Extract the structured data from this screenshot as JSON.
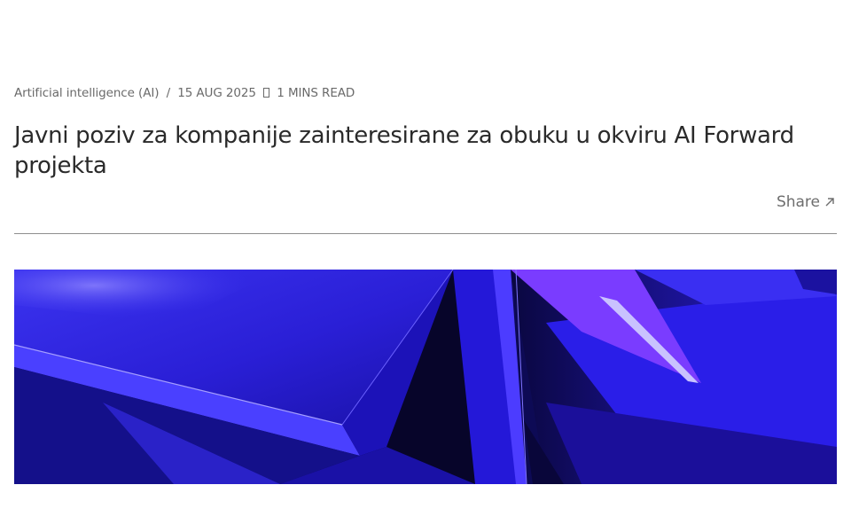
{
  "article": {
    "category": "Artificial intelligence (AI)",
    "separator": "/",
    "date": "15 AUG 2025",
    "read_time": "1 MINS READ",
    "title": "Javni poziv za kompanije zainteresirane za obuku u okviru AI Forward projekta",
    "share_label": "Share"
  },
  "icons": {
    "share": "arrow-up-right-icon",
    "read_time": "clock-icon"
  },
  "colors": {
    "hero_primary": "#2a1ee0",
    "hero_dark": "#0b0a3a",
    "hero_violet": "#7a3cff",
    "divider": "#8e8e8e"
  }
}
